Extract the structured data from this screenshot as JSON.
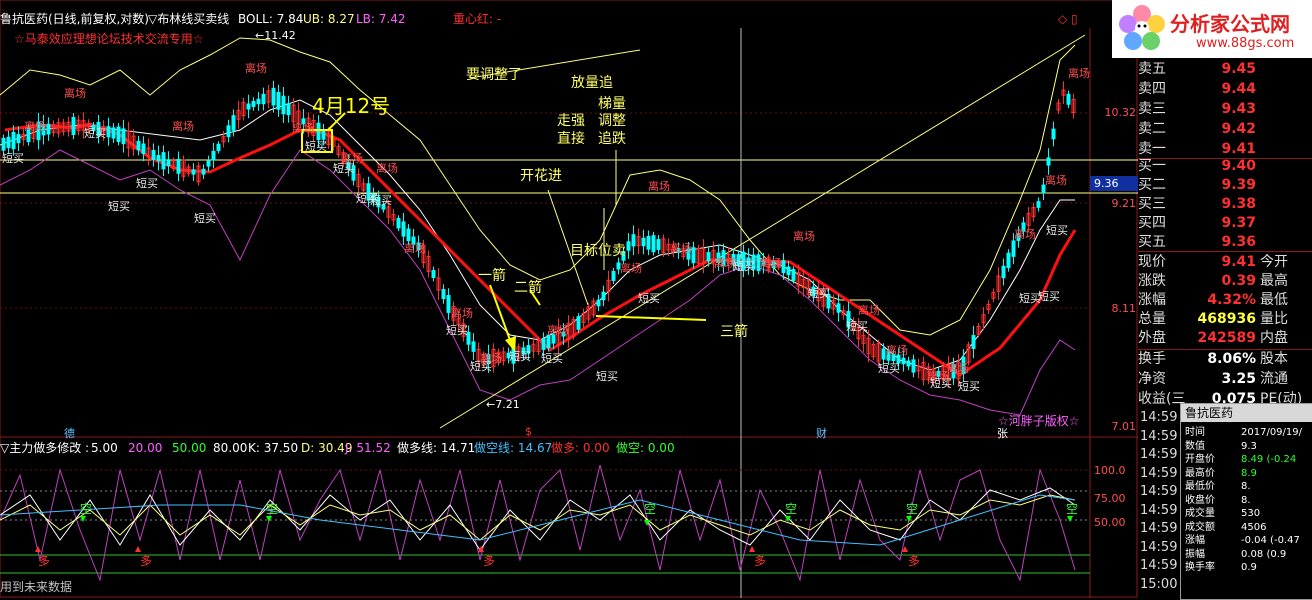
{
  "header": {
    "title": "鲁抗医药(日线,前复权,对数)",
    "indicator": "▽布林线买卖线",
    "boll": "BOLL: 7.84",
    "ub": "UB: 8.27",
    "lb": "LB: 7.42",
    "center_red": "重心红: -",
    "watermark": "☆马泰效应理想论坛技术交流专用☆"
  },
  "logo": {
    "text": "分析家公式网",
    "url": "www.88gs.com"
  },
  "price_axis": [
    "10.32",
    "9.21",
    "8.11",
    "7.01"
  ],
  "cursor_price": "9.36",
  "hi_mark": "11.42",
  "lo_mark": "7.21",
  "annotations": {
    "date_note": "4月12号",
    "adjust": "要调整了",
    "volume_chase": "放量追",
    "shrink": "梯量",
    "adjust2": "调整",
    "strong": "走强",
    "direct": "直接",
    "pullback": "追跌",
    "bloom": "开花进",
    "target": "目标位卖",
    "arrow1": "一箭",
    "arrow2": "二箭",
    "arrow3": "三箭",
    "copyright": "☆河胖子版权☆"
  },
  "chart_tags": {
    "long": "离场",
    "short": "短买"
  },
  "markers": [
    "德",
    "$",
    "财",
    "张"
  ],
  "indicator": {
    "title": "▽主力做多修改 :",
    "p1": "5.00",
    "p2": "20.00",
    "p3": "50.00",
    "p4": "80.00",
    "k": "K: 37.50",
    "d": "D: 30.49",
    "j": "J: 51.52",
    "duo_line": "做多线: 14.71",
    "kong_line": "做空线: 14.67",
    "duo": "做多: 0.00",
    "kong": "做空: 0.00",
    "levels": [
      "100.0",
      "75.00",
      "50.00"
    ],
    "sig_kong": "空",
    "sig_duo": "多",
    "footnote": "用到未来数据"
  },
  "quotes": {
    "sell": [
      {
        "label": "卖五",
        "val": "9.45"
      },
      {
        "label": "卖四",
        "val": "9.44"
      },
      {
        "label": "卖三",
        "val": "9.43"
      },
      {
        "label": "卖二",
        "val": "9.42"
      },
      {
        "label": "卖一",
        "val": "9.41"
      }
    ],
    "buy": [
      {
        "label": "买一",
        "val": "9.40"
      },
      {
        "label": "买二",
        "val": "9.39"
      },
      {
        "label": "买三",
        "val": "9.38"
      },
      {
        "label": "买四",
        "val": "9.37"
      },
      {
        "label": "买五",
        "val": "9.36"
      }
    ],
    "stats": [
      {
        "label": "现价",
        "val": "9.41",
        "extra": "今开"
      },
      {
        "label": "涨跌",
        "val": "0.39",
        "extra": "最高"
      },
      {
        "label": "涨幅",
        "val": "4.32%",
        "extra": "最低"
      },
      {
        "label": "总量",
        "val": "468936",
        "extra": "量比"
      },
      {
        "label": "外盘",
        "val": "242589",
        "extra": "内盘"
      }
    ],
    "stats2": [
      {
        "label": "换手",
        "val": "8.06%",
        "extra": "股本"
      },
      {
        "label": "净资",
        "val": "3.25",
        "extra": "流通"
      },
      {
        "label": "收益(三",
        "val": "0.075",
        "extra": "PE(动)"
      }
    ]
  },
  "times": [
    "14:59",
    "14:59",
    "14:59",
    "14:59",
    "14:59",
    "14:59",
    "14:59",
    "14:59",
    "14:59",
    "15:00"
  ],
  "popup": {
    "title": "鲁抗医药",
    "rows": [
      {
        "k": "时间",
        "v": "2017/09/19/"
      },
      {
        "k": "数值",
        "v": "9.3"
      },
      {
        "k": "开盘价",
        "v": "8.49 (-0.24"
      },
      {
        "k": "最高价",
        "v": "8.9"
      },
      {
        "k": "最低价",
        "v": "8."
      },
      {
        "k": "收盘价",
        "v": "8."
      },
      {
        "k": "成交量",
        "v": "530"
      },
      {
        "k": "成交额",
        "v": "4506"
      },
      {
        "k": "涨幅",
        "v": "-0.04 (-0.47"
      },
      {
        "k": "振幅",
        "v": "0.08 (0.9"
      },
      {
        "k": "换手率",
        "v": "0.9"
      }
    ]
  },
  "colors": {
    "up": "#ff3030",
    "down": "#00ffff",
    "boll_upper": "#ffff80",
    "boll_lower": "#c040c0",
    "mid_red": "#ff1010",
    "yellow": "#ffff00"
  }
}
